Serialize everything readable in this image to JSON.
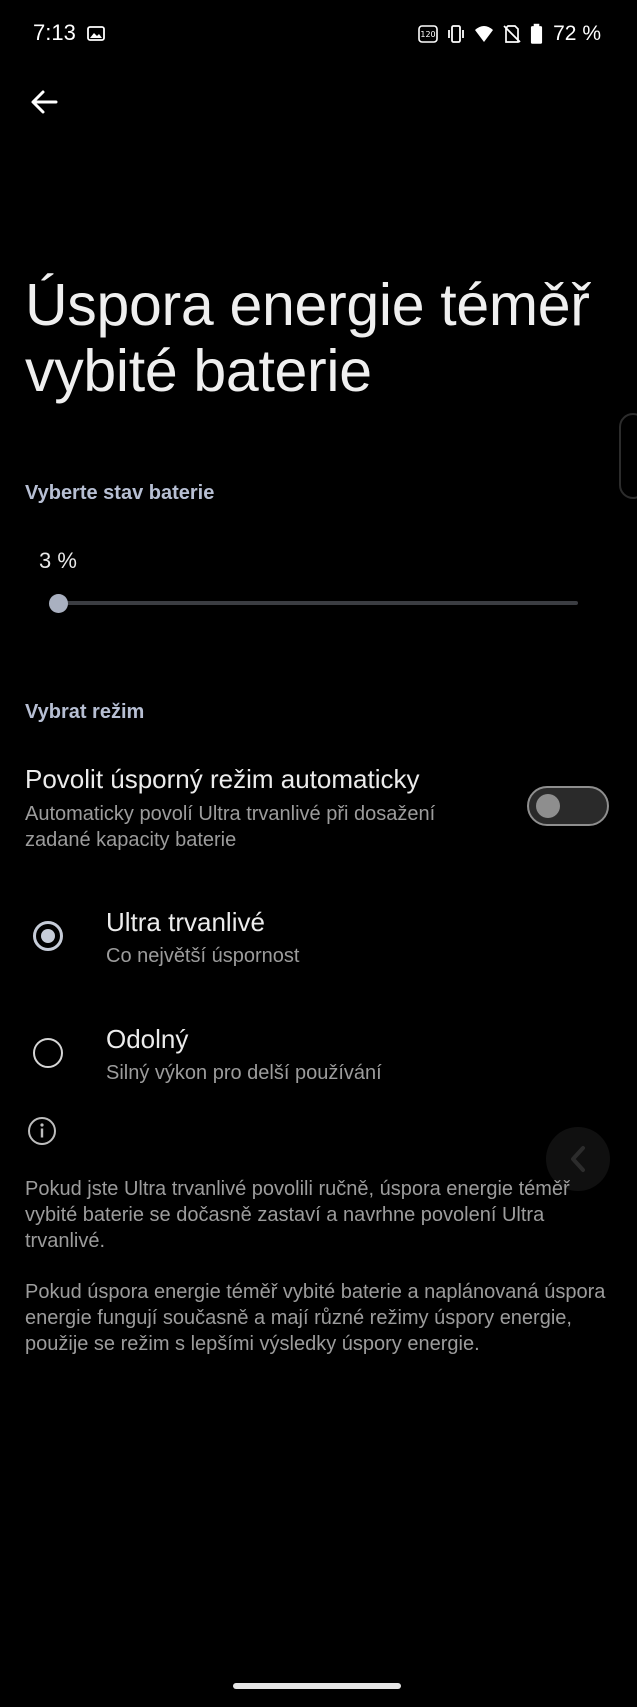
{
  "status_bar": {
    "time": "7:13",
    "battery_percent": "72 %",
    "icons": [
      "gallery-icon",
      "refresh-rate-120-icon",
      "vibrate-icon",
      "wifi-icon",
      "no-sim-icon",
      "battery-icon"
    ]
  },
  "page": {
    "title_line1": "Úspora energie téměř",
    "title_line2": "vybité baterie"
  },
  "battery_level": {
    "label": "Vyberte stav baterie",
    "value_text": "3 %",
    "value_fraction": 0.0
  },
  "mode": {
    "label": "Vybrat režim",
    "auto": {
      "title": "Povolit úsporný režim automaticky",
      "description": "Automaticky povolí Ultra trvanlivé při dosažení zadané kapacity baterie",
      "enabled": false
    },
    "options": [
      {
        "title": "Ultra trvanlivé",
        "subtitle": "Co největší úspornost",
        "selected": true
      },
      {
        "title": "Odolný",
        "subtitle": "Silný výkon pro delší používání",
        "selected": false
      }
    ]
  },
  "info": {
    "paragraph1": "Pokud jste Ultra trvanlivé povolili ručně, úspora energie téměř vybité baterie se dočasně zastaví a navrhne povolení Ultra trvanlivé.",
    "paragraph2": "Pokud úspora energie téměř vybité baterie a naplánovaná úspora energie fungují současně a mají různé režimy úspory energie, použije se režim s lepšími výsledky úspory energie."
  },
  "colors": {
    "background": "#000000",
    "accent": "#c6ccd8",
    "section_label": "#b7bfd3",
    "secondary_text": "#9c9c9c"
  }
}
